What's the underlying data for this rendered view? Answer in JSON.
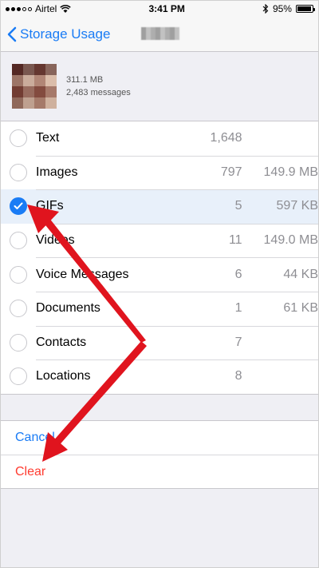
{
  "status_bar": {
    "carrier": "Airtel",
    "time": "3:41 PM",
    "battery": "95%",
    "battery_level": 0.95
  },
  "nav": {
    "back_label": "Storage Usage"
  },
  "contact": {
    "size": "311.1 MB",
    "messages": "2,483 messages"
  },
  "items": [
    {
      "label": "Text",
      "count": "1,648",
      "size": "",
      "checked": false
    },
    {
      "label": "Images",
      "count": "797",
      "size": "149.9 MB",
      "checked": false
    },
    {
      "label": "GIFs",
      "count": "5",
      "size": "597 KB",
      "checked": true
    },
    {
      "label": "Videos",
      "count": "11",
      "size": "149.0 MB",
      "checked": false
    },
    {
      "label": "Voice Messages",
      "count": "6",
      "size": "44 KB",
      "checked": false
    },
    {
      "label": "Documents",
      "count": "1",
      "size": "61 KB",
      "checked": false
    },
    {
      "label": "Contacts",
      "count": "7",
      "size": "",
      "checked": false
    },
    {
      "label": "Locations",
      "count": "8",
      "size": "",
      "checked": false
    }
  ],
  "actions": {
    "cancel": "Cancel",
    "clear": "Clear"
  },
  "colors": {
    "accent": "#1a7cf5",
    "destructive": "#ff3b30",
    "annotation_arrow": "#e0141e"
  }
}
